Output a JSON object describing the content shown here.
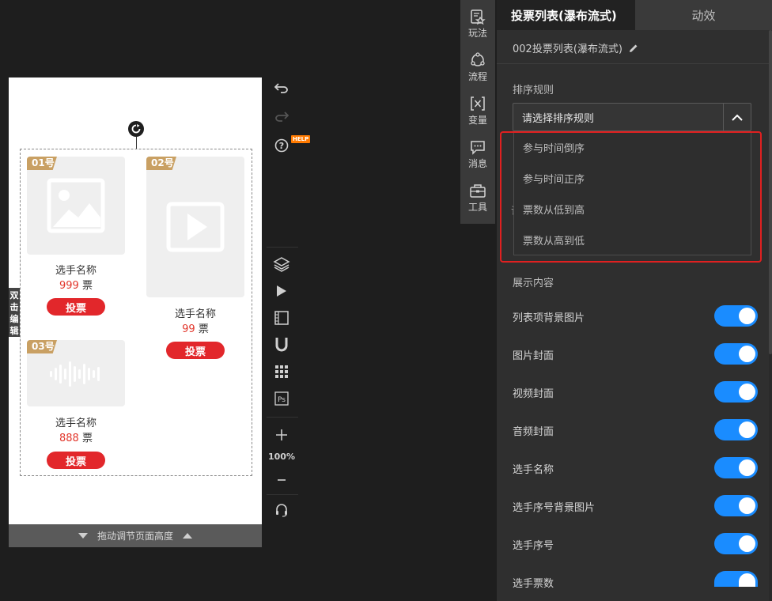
{
  "canvas": {
    "height_bar_label": "拖动调节页面高度",
    "side_edit_label": "双击编辑",
    "cards": [
      {
        "badge": "01号",
        "name": "选手名称",
        "votes": "999",
        "unit": "票",
        "button": "投票",
        "media": "image-placeholder-icon"
      },
      {
        "badge": "02号",
        "name": "选手名称",
        "votes": "99",
        "unit": "票",
        "button": "投票",
        "media": "video-placeholder-icon"
      },
      {
        "badge": "03号",
        "name": "选手名称",
        "votes": "888",
        "unit": "票",
        "button": "投票",
        "media": "audio-placeholder-icon"
      }
    ]
  },
  "toolbar": {
    "help_badge": "HELP",
    "zoom": "100%",
    "zoom_in": "+",
    "zoom_out": "−"
  },
  "nav": {
    "items": [
      {
        "label": "玩法",
        "icon": "gameplay-icon"
      },
      {
        "label": "流程",
        "icon": "flow-icon"
      },
      {
        "label": "变量",
        "icon": "variable-icon"
      },
      {
        "label": "消息",
        "icon": "message-icon"
      },
      {
        "label": "工具",
        "icon": "toolbox-icon"
      }
    ]
  },
  "panel": {
    "tabs": [
      {
        "label": "投票列表(瀑布流式)"
      },
      {
        "label": "动效"
      }
    ],
    "component_title": "002投票列表(瀑布流式)",
    "sort_label": "排序规则",
    "sort_placeholder": "请选择排序规则",
    "sort_options": [
      "参与时间倒序",
      "参与时间正序",
      "票数从低到高",
      "票数从高到低"
    ],
    "hidden_char": "词",
    "display_label": "展示内容",
    "toggles": [
      {
        "label": "列表项背景图片",
        "on": true
      },
      {
        "label": "图片封面",
        "on": true
      },
      {
        "label": "视频封面",
        "on": true
      },
      {
        "label": "音频封面",
        "on": true
      },
      {
        "label": "选手名称",
        "on": true
      },
      {
        "label": "选手序号背景图片",
        "on": true
      },
      {
        "label": "选手序号",
        "on": true
      },
      {
        "label": "选手票数",
        "on": true
      }
    ]
  },
  "colors": {
    "accent": "#1a8cff",
    "vote_button": "#e2272b",
    "badge": "#c9a063",
    "highlight_frame": "#e02020"
  }
}
